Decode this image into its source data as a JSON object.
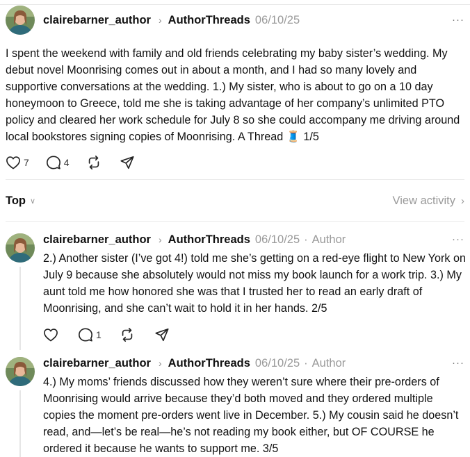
{
  "post": {
    "username": "clairebarner_author",
    "community": "AuthorThreads",
    "date": "06/10/25",
    "text": "I spent the weekend with family and old friends celebrating my baby sister’s wedding. My debut novel Moonrising comes out in about a month, and I had so many lovely and supportive conversations at the wedding. 1.) My sister, who is about to go on a 10 day honeymoon to Greece, told me she is taking advantage of her company’s unlimited PTO policy and cleared her work schedule for July 8 so she could accompany me driving around local bookstores signing copies of Moonrising. A Thread 🧵 1/5",
    "likes": "7",
    "replies": "4",
    "more_label": "···"
  },
  "sortbar": {
    "sort_label": "Top",
    "view_activity": "View activity"
  },
  "replies": [
    {
      "username": "clairebarner_author",
      "community": "AuthorThreads",
      "date": "06/10/25",
      "role": "Author",
      "text": "2.) Another sister (I’ve got 4!) told me she’s getting on a red-eye flight to New York on July 9 because she absolutely would not miss my book launch for a work trip. 3.) My aunt told me how honored she was that I trusted her to read an early draft of Moonrising, and she can’t wait to hold it in her hands. 2/5",
      "likes": "",
      "replies": "1"
    },
    {
      "username": "clairebarner_author",
      "community": "AuthorThreads",
      "date": "06/10/25",
      "role": "Author",
      "text": "4.) My moms’ friends discussed how they weren’t sure where their pre-orders of Moonrising would arrive because they’d both moved and they ordered multiple copies the moment pre-orders went live in December. 5.) My cousin said he doesn’t read, and—let’s be real—he’s not reading my book either, but OF COURSE he ordered it because he wants to support me. 3/5"
    }
  ],
  "icons": {
    "heart": "heart-icon",
    "reply": "comment-icon",
    "repost": "repost-icon",
    "share": "send-icon",
    "more": "more-options-icon"
  }
}
